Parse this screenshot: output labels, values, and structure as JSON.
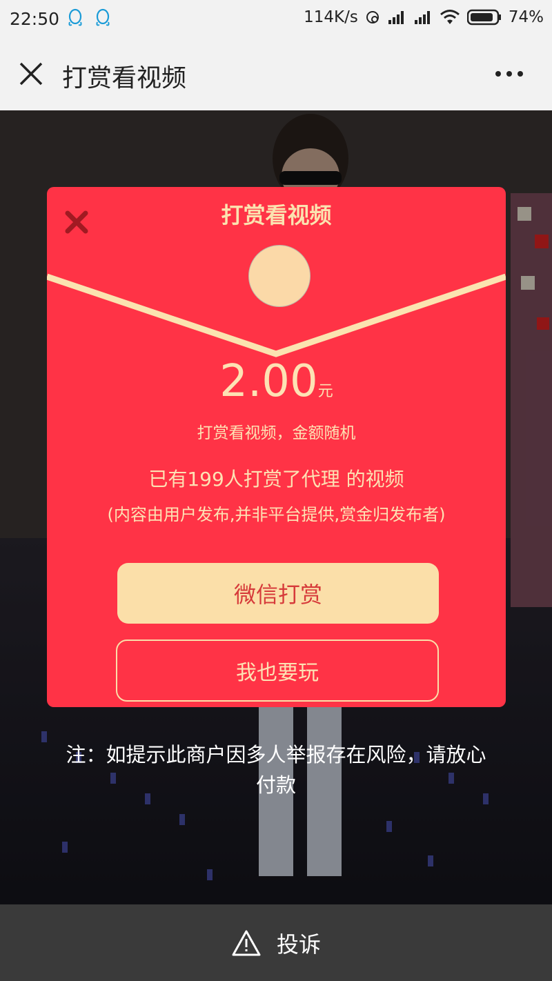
{
  "status_bar": {
    "time": "22:50",
    "network_speed": "114K/s",
    "battery": "74%"
  },
  "app_bar": {
    "title": "打赏看视频"
  },
  "modal": {
    "title": "打赏看视频",
    "amount": "2.00",
    "unit": "元",
    "subtitle": "打赏看视频，金额随机",
    "count_text": "已有199人打赏了代理 的视频",
    "disclaimer": "(内容由用户发布,并非平台提供,赏金归发布者)",
    "primary_button": "微信打赏",
    "secondary_button": "我也要玩"
  },
  "note": "注：如提示此商户因多人举报存在风险，请放心付款",
  "bottom_bar": {
    "label": "投诉"
  },
  "colors": {
    "modal_red": "#ff3346",
    "cream": "#fbdfa9",
    "accent_text": "#d63a3a"
  }
}
